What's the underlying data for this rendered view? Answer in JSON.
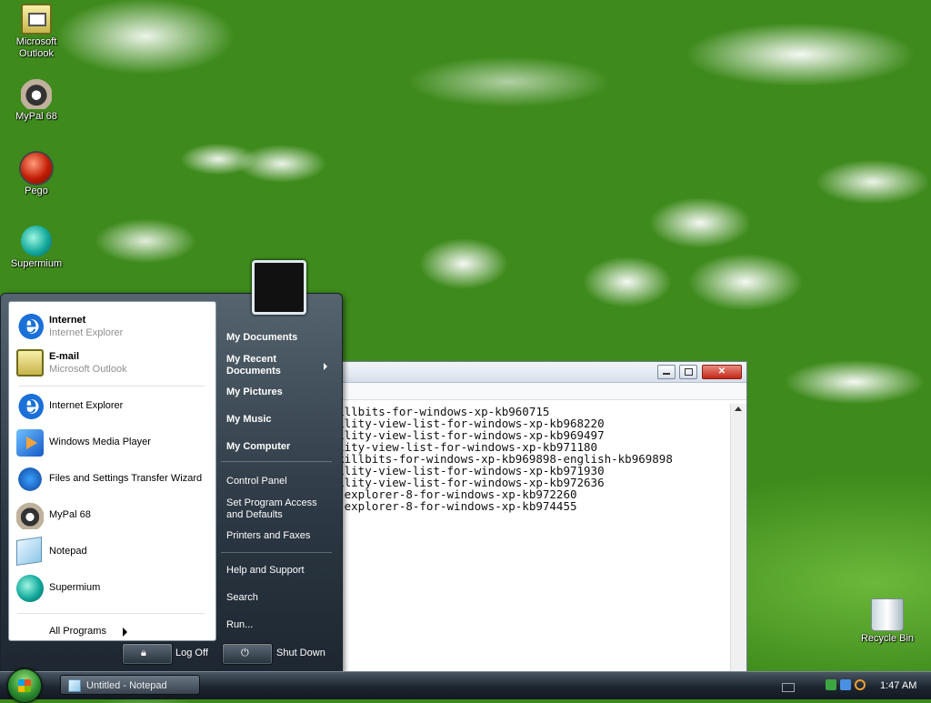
{
  "desktop": {
    "icons": [
      {
        "label_line1": "Microsoft",
        "label_line2": "Outlook",
        "icon": "outlook-icon"
      },
      {
        "label_line1": "MyPal 68",
        "label_line2": "",
        "icon": "mypal-icon"
      },
      {
        "label_line1": "Pego",
        "label_line2": "",
        "icon": "pego-icon"
      },
      {
        "label_line1": "Supermium",
        "label_line2": "",
        "icon": "supermium-icon"
      }
    ],
    "recycle_bin": {
      "label": "Recycle Bin",
      "icon": "recycle-bin-icon"
    }
  },
  "notepad": {
    "title": "Untitled - Notepad",
    "lines": [
      "ex-killbits-for-windows-xp-kb960715",
      "atibility-view-list-for-windows-xp-kb968220",
      "atibility-view-list-for-windows-xp-kb969497",
      "tibility-view-list-for-windows-xp-kb971180",
      "vex-killbits-for-windows-xp-kb969898-english-kb969898",
      "atibility-view-list-for-windows-xp-kb971930",
      "atibility-view-list-for-windows-xp-kb972636",
      "rnet-explorer-8-for-windows-xp-kb972260",
      "rnet-explorer-8-for-windows-xp-kb974455"
    ]
  },
  "start_menu": {
    "pinned": [
      {
        "title": "Internet",
        "subtitle": "Internet Explorer",
        "icon": "internet-explorer-icon"
      },
      {
        "title": "E-mail",
        "subtitle": "Microsoft Outlook",
        "icon": "outlook-icon"
      }
    ],
    "recent": [
      {
        "label": "Internet Explorer",
        "icon": "internet-explorer-icon"
      },
      {
        "label": "Windows Media Player",
        "icon": "media-player-icon"
      },
      {
        "label": "Files and Settings Transfer Wizard",
        "icon": "transfer-wizard-icon"
      },
      {
        "label": "MyPal 68",
        "icon": "mypal-icon"
      },
      {
        "label": "Notepad",
        "icon": "notepad-icon"
      },
      {
        "label": "Supermium",
        "icon": "supermium-icon"
      }
    ],
    "all_programs": "All Programs",
    "right": {
      "my_documents": "My Documents",
      "my_recent_1": "My Recent",
      "my_recent_2": "Documents",
      "my_pictures": "My Pictures",
      "my_music": "My Music",
      "my_computer": "My Computer",
      "control_panel": "Control Panel",
      "set_access_1": "Set Program Access",
      "set_access_2": "and Defaults",
      "printers": "Printers and Faxes",
      "help": "Help and Support",
      "search": "Search",
      "run": "Run..."
    },
    "log_off": "Log Off",
    "shut_down": "Shut Down"
  },
  "taskbar": {
    "task_notepad": "Untitled - Notepad",
    "clock": "1:47 AM"
  }
}
